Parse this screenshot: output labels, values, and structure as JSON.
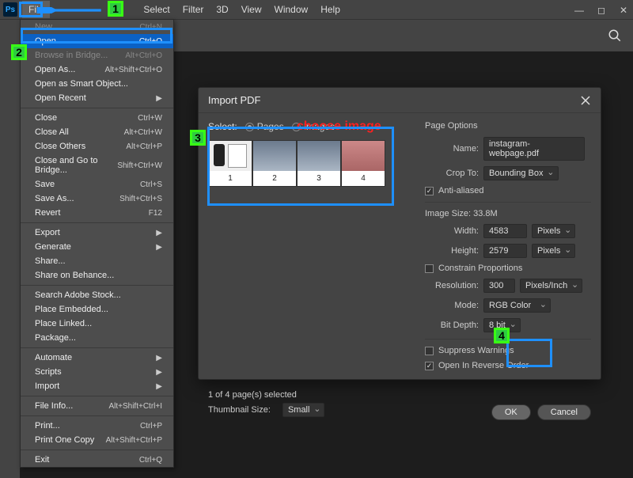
{
  "menubar": {
    "items": [
      "File",
      "",
      "",
      "Select",
      "Filter",
      "3D",
      "View",
      "Window",
      "Help"
    ]
  },
  "file_menu": {
    "groups": [
      [
        {
          "label": "New...",
          "shortcut": "Ctrl+N",
          "disabled": true
        },
        {
          "label": "Open...",
          "shortcut": "Ctrl+O",
          "highlight": true
        },
        {
          "label": "Browse in Bridge...",
          "shortcut": "Alt+Ctrl+O",
          "disabled": true
        },
        {
          "label": "Open As...",
          "shortcut": "Alt+Shift+Ctrl+O"
        },
        {
          "label": "Open as Smart Object..."
        },
        {
          "label": "Open Recent",
          "submenu": true
        }
      ],
      [
        {
          "label": "Close",
          "shortcut": "Ctrl+W"
        },
        {
          "label": "Close All",
          "shortcut": "Alt+Ctrl+W"
        },
        {
          "label": "Close Others",
          "shortcut": "Alt+Ctrl+P"
        },
        {
          "label": "Close and Go to Bridge...",
          "shortcut": "Shift+Ctrl+W"
        },
        {
          "label": "Save",
          "shortcut": "Ctrl+S"
        },
        {
          "label": "Save As...",
          "shortcut": "Shift+Ctrl+S"
        },
        {
          "label": "Revert",
          "shortcut": "F12"
        }
      ],
      [
        {
          "label": "Export",
          "submenu": true
        },
        {
          "label": "Generate",
          "submenu": true
        },
        {
          "label": "Share..."
        },
        {
          "label": "Share on Behance..."
        }
      ],
      [
        {
          "label": "Search Adobe Stock..."
        },
        {
          "label": "Place Embedded..."
        },
        {
          "label": "Place Linked..."
        },
        {
          "label": "Package..."
        }
      ],
      [
        {
          "label": "Automate",
          "submenu": true
        },
        {
          "label": "Scripts",
          "submenu": true
        },
        {
          "label": "Import",
          "submenu": true
        }
      ],
      [
        {
          "label": "File Info...",
          "shortcut": "Alt+Shift+Ctrl+I"
        }
      ],
      [
        {
          "label": "Print...",
          "shortcut": "Ctrl+P"
        },
        {
          "label": "Print One Copy",
          "shortcut": "Alt+Shift+Ctrl+P"
        }
      ],
      [
        {
          "label": "Exit",
          "shortcut": "Ctrl+Q"
        }
      ]
    ]
  },
  "dialog": {
    "title": "Import PDF",
    "select_label": "Select:",
    "radio_pages": "Pages",
    "radio_images": "Images",
    "thumb_nums": [
      "1",
      "2",
      "3",
      "4"
    ],
    "footer_status": "1 of 4 page(s) selected",
    "thumb_size_label": "Thumbnail Size:",
    "thumb_size_value": "Small",
    "page_options": "Page Options",
    "name_label": "Name:",
    "name_value": "instagram-webpage.pdf",
    "crop_label": "Crop To:",
    "crop_value": "Bounding Box",
    "antialias": "Anti-aliased",
    "image_size_label": "Image Size: 33.8M",
    "width_label": "Width:",
    "width_value": "4583",
    "height_label": "Height:",
    "height_value": "2579",
    "unit_pixels": "Pixels",
    "constrain": "Constrain Proportions",
    "resolution_label": "Resolution:",
    "resolution_value": "300",
    "resolution_unit": "Pixels/Inch",
    "mode_label": "Mode:",
    "mode_value": "RGB Color",
    "bitdepth_label": "Bit Depth:",
    "bitdepth_value": "8 bit",
    "suppress": "Suppress Warnings",
    "reverse": "Open In Reverse Order",
    "ok": "OK",
    "cancel": "Cancel"
  },
  "annotations": {
    "choose_image": "choose image",
    "c1": "1",
    "c2": "2",
    "c3": "3",
    "c4": "4"
  }
}
